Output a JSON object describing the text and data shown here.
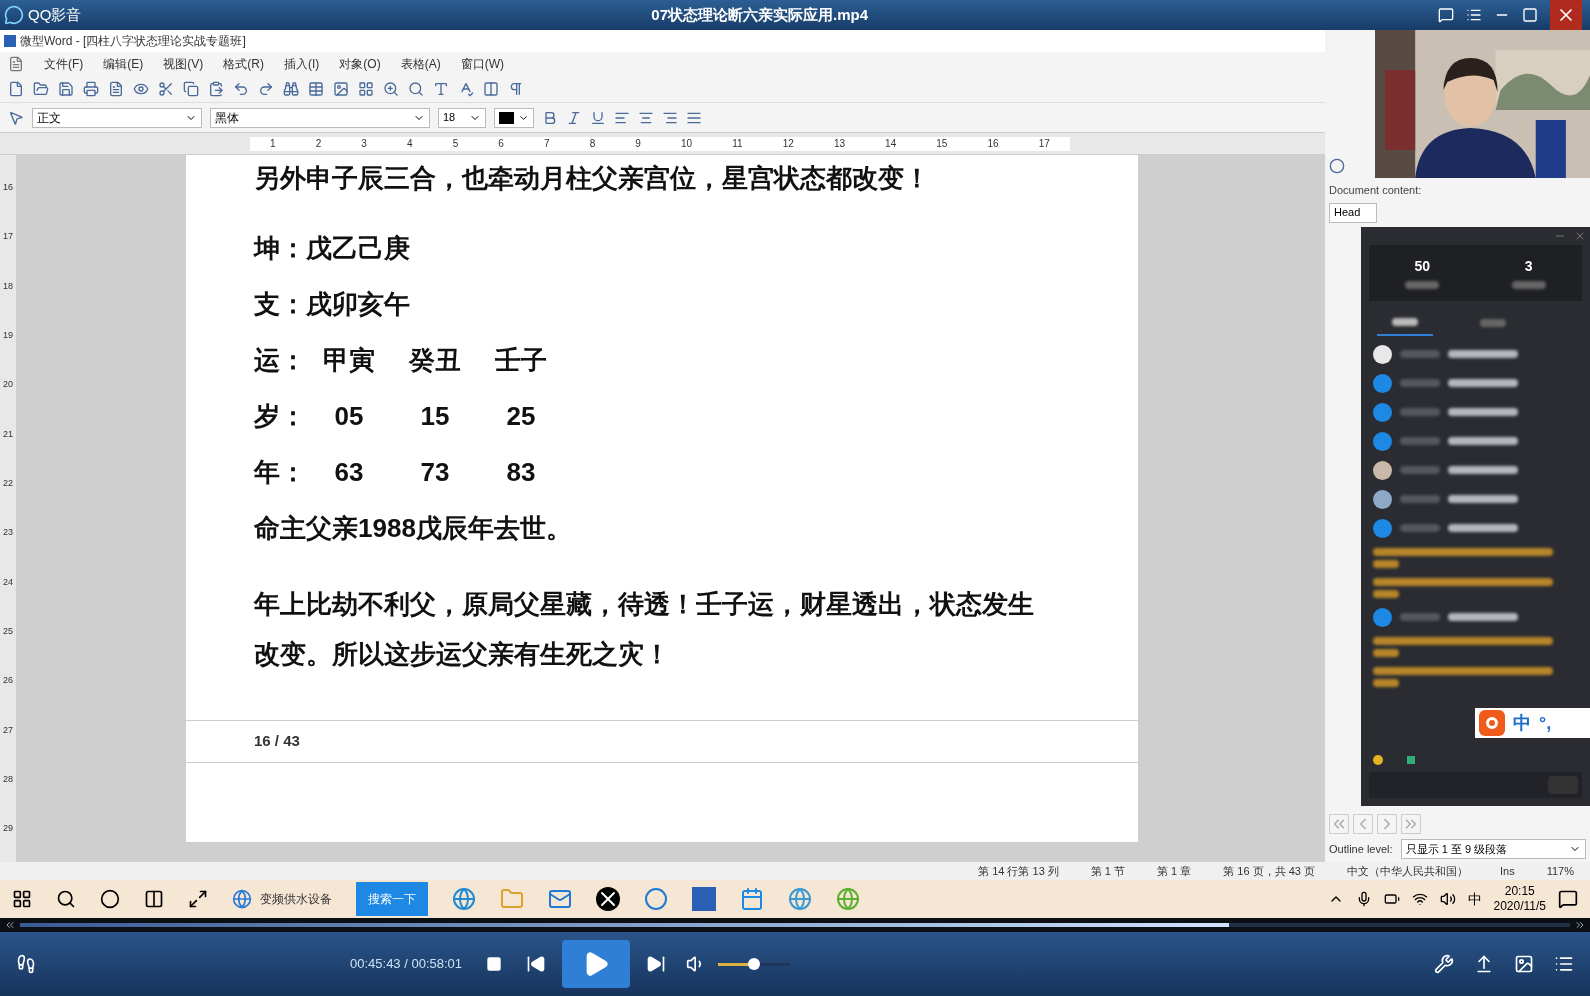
{
  "player": {
    "app_name": "QQ影音",
    "title": "07状态理论断六亲实际应用.mp4",
    "time": "00:45:43 / 00:58:01",
    "seek": {
      "level": 0.78
    },
    "volume": {
      "level": 0.5
    }
  },
  "word": {
    "title": "微型Word - [四柱八字状态理论实战专题班]",
    "menu": [
      "文件(F)",
      "编辑(E)",
      "视图(V)",
      "格式(R)",
      "插入(I)",
      "对象(O)",
      "表格(A)",
      "窗口(W)"
    ],
    "style": "正文",
    "font": "黑体",
    "size": "18",
    "ruler": [
      "1",
      "2",
      "3",
      "4",
      "5",
      "6",
      "7",
      "8",
      "9",
      "10",
      "11",
      "12",
      "13",
      "14",
      "15",
      "16",
      "17"
    ],
    "vertical_ruler": [
      "16",
      "17",
      "18",
      "19",
      "20",
      "21",
      "22",
      "23",
      "24",
      "25",
      "26",
      "27",
      "28",
      "29"
    ],
    "lines": [
      {
        "kind": "text",
        "text": "另外申子辰三合，也牵动月柱父亲宫位，星宫状态都改变！"
      },
      {
        "kind": "row",
        "label": "坤：",
        "cells": [
          "戊乙己庚"
        ]
      },
      {
        "kind": "row",
        "label": "支：",
        "cells": [
          "戌卯亥午"
        ]
      },
      {
        "kind": "row",
        "label": "运：",
        "cells": [
          "甲寅",
          "癸丑",
          "壬子"
        ]
      },
      {
        "kind": "row",
        "label": "岁：",
        "cells": [
          "05",
          "15",
          "25"
        ]
      },
      {
        "kind": "row",
        "label": "年：",
        "cells": [
          "63",
          "73",
          "83"
        ]
      },
      {
        "kind": "text",
        "text": "命主父亲1988戊辰年去世。"
      },
      {
        "kind": "text",
        "text": "年上比劫不利父，原局父星藏，待透！壬子运，财星透出，状态发生改变。所以这步运父亲有生死之灾！"
      }
    ],
    "page_number": "16 / 43",
    "side": {
      "doc_label": "Document content:",
      "doc_field": "Head",
      "outline_label": "Outline level:",
      "outline_value": "只显示 1 至 9 级段落"
    },
    "status": [
      "第 14 行第 13 列",
      "第 1 节",
      "第 1 章",
      "第 16 页，共 43 页",
      "中文（中华人民共和国）",
      "Ins",
      "117%"
    ]
  },
  "chat": {
    "stats": [
      "50",
      "3"
    ],
    "tabs": [
      {
        "selected": true
      },
      {
        "selected": false
      }
    ],
    "messages": [
      {
        "kind": "user",
        "color": "#e8e8e8"
      },
      {
        "kind": "user",
        "color": "#1e88e5"
      },
      {
        "kind": "user",
        "color": "#1e88e5"
      },
      {
        "kind": "user",
        "color": "#1e88e5"
      },
      {
        "kind": "user",
        "color": "#c8b8a8"
      },
      {
        "kind": "user",
        "color": "#8ea8c8"
      },
      {
        "kind": "user",
        "color": "#1e88e5"
      },
      {
        "kind": "notice"
      },
      {
        "kind": "notice"
      },
      {
        "kind": "user",
        "color": "#1e88e5"
      },
      {
        "kind": "notice"
      },
      {
        "kind": "notice"
      }
    ],
    "ime": [
      "中",
      "°,"
    ]
  },
  "taskbar": {
    "search_text": "变频供水设备",
    "search_button": "搜索一下",
    "ime": "中",
    "time": "20:15",
    "date": "2020/11/5"
  }
}
